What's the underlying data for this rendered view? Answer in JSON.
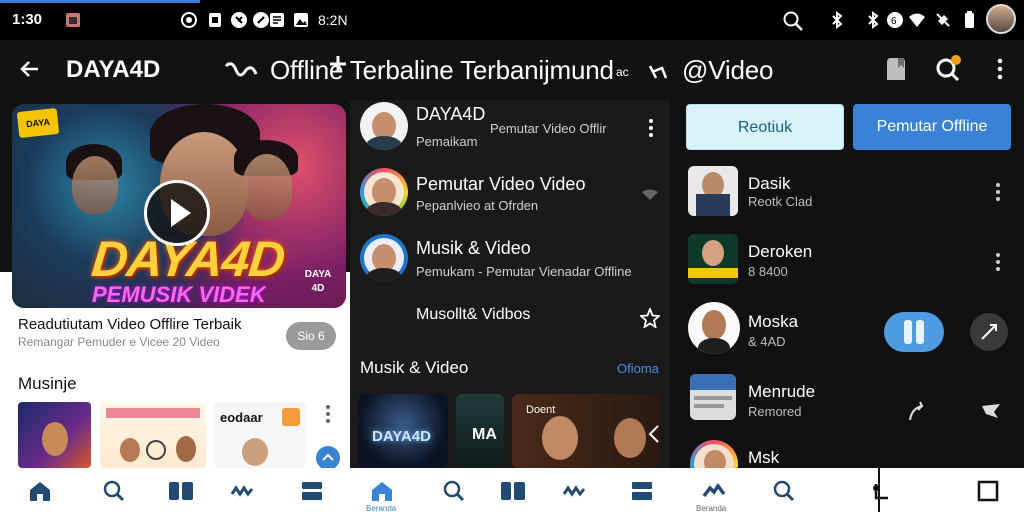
{
  "status_bar": {
    "time": "1:30",
    "clock": "8:2N",
    "icons": [
      "gallery-icon",
      "cast-icon",
      "sim-icon",
      "whatsapp-icon",
      "news-icon",
      "photo-icon"
    ],
    "right_icons": [
      "search-icon",
      "bluetooth-icon",
      "bluetooth-icon",
      "data-icon",
      "wifi-icon",
      "mute-icon",
      "battery-icon",
      "profile-avatar"
    ]
  },
  "app_bar": {
    "title": "DAYA4D",
    "subtitle": "Offline Terbaline Terbanijmund",
    "subtitle_end": "@Video",
    "actions": [
      "share-icon",
      "add-icon",
      "bookmark-icon",
      "search-notification-icon",
      "more-icon"
    ]
  },
  "featured": {
    "thumb_badge": "DAYA",
    "thumb_logo": "DAYA4D",
    "thumb_tagline": "PEMUSIK VIDEK",
    "thumb_corner": "DAYA 4D",
    "title": "Readutiutam Video Offlire Terbaik",
    "subtitle": "Remangar Pemuder e Vicee 20 Video",
    "chip": "Sio 6",
    "section_title": "Musinje",
    "mini_label": "eodaar"
  },
  "mid_list": [
    {
      "title": "DAYA4D",
      "subtitle": "Pemaikam",
      "extra": "Pemutar Video Offlir"
    },
    {
      "title": "Pemutar Video Video",
      "subtitle": "Pepanlvieo at Ofrden"
    },
    {
      "title": "Musik & Video",
      "subtitle": "Pemukam - Pemutar Vienadar Offline"
    },
    {
      "title": "Musollt& Vidbos",
      "subtitle": ""
    }
  ],
  "mid_section": {
    "title": "Musik & Video",
    "link": "Ofioma",
    "thumbs": [
      "DAYA4D",
      "MA",
      "Doent"
    ]
  },
  "right_panel": {
    "button_light": "Reotiuk",
    "button_primary": "Pemutar Offline",
    "items": [
      {
        "title": "Dasik",
        "subtitle": "Reotk Clad"
      },
      {
        "title": "Deroken",
        "subtitle": "8 8400"
      },
      {
        "title": "Moska",
        "subtitle": "& 4AD"
      },
      {
        "title": "Menrude",
        "subtitle": "Remored"
      },
      {
        "title": "Msk",
        "subtitle": ""
      }
    ]
  },
  "bottom_nav": {
    "items": [
      "home-icon",
      "search-icon",
      "library-icon",
      "music-icon",
      "queue-icon",
      "home-icon",
      "search-icon",
      "library-icon",
      "music-icon",
      "queue-icon",
      "music-icon",
      "search-icon",
      "back-icon",
      "square-icon"
    ],
    "active_label": "Beranda",
    "label2": "Beranda"
  },
  "colors": {
    "accent": "#3a82d5",
    "background": "#121212",
    "light_button": "#d9f3fb"
  }
}
